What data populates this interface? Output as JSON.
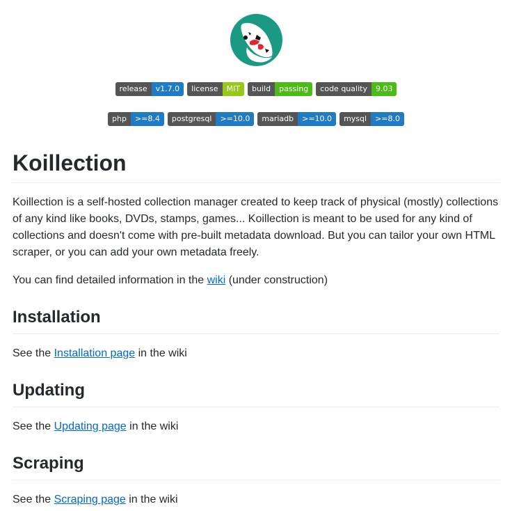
{
  "logo": {
    "icon": "koi-fish-logo",
    "bg_color": "#1a9a83"
  },
  "badges_row1": [
    {
      "label": "release",
      "value": "v1.7.0",
      "color": "#1f7bc6"
    },
    {
      "label": "license",
      "value": "MIT",
      "color": "#97c91a"
    },
    {
      "label": "build",
      "value": "passing",
      "color": "#4cbb17"
    },
    {
      "label": "code quality",
      "value": "9.03",
      "color": "#4cbb17"
    }
  ],
  "badges_row2": [
    {
      "label": "php",
      "value": ">=8.4",
      "color": "#1f7bc6"
    },
    {
      "label": "postgresql",
      "value": ">=10.0",
      "color": "#1f7bc6"
    },
    {
      "label": "mariadb",
      "value": ">=10.0",
      "color": "#1f7bc6"
    },
    {
      "label": "mysql",
      "value": ">=8.0",
      "color": "#1f7bc6"
    }
  ],
  "title": "Koillection",
  "intro": "Koillection is a self-hosted collection manager created to keep track of physical (mostly) collections of any kind like books, DVDs, stamps, games... Koillection is meant to be used for any kind of collections and doesn't come with pre-built metadata download. But you can tailor your own HTML scraper, or you can add your own metadata freely.",
  "wiki_line": {
    "prefix": "You can find detailed information in the ",
    "link": "wiki",
    "suffix": " (under construction)"
  },
  "sections": [
    {
      "heading": "Installation",
      "prefix": "See the ",
      "link": "Installation page",
      "suffix": " in the wiki"
    },
    {
      "heading": "Updating",
      "prefix": "See the ",
      "link": "Updating page",
      "suffix": " in the wiki"
    },
    {
      "heading": "Scraping",
      "prefix": "See the ",
      "link": "Scraping page",
      "suffix": " in the wiki"
    }
  ]
}
